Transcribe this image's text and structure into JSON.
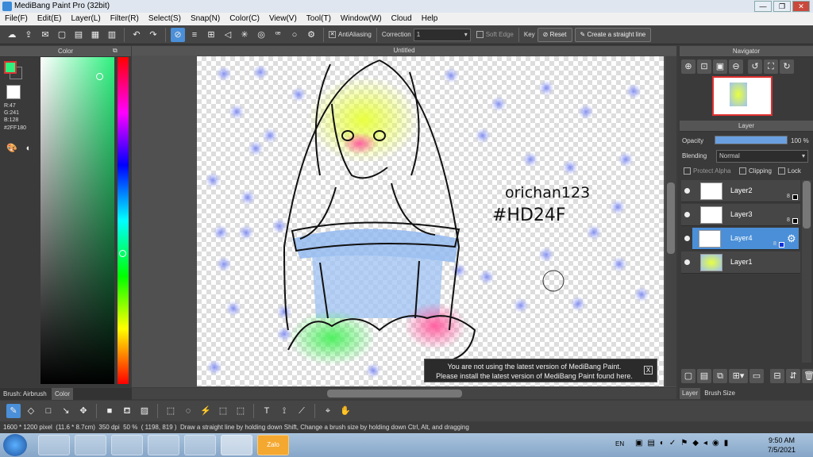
{
  "window": {
    "title": "MediBang Paint Pro (32bit)"
  },
  "menu": [
    "File(F)",
    "Edit(E)",
    "Layer(L)",
    "Filter(R)",
    "Select(S)",
    "Snap(N)",
    "Color(C)",
    "View(V)",
    "Tool(T)",
    "Window(W)",
    "Cloud",
    "Help"
  ],
  "toolbar": {
    "antialiasing_label": "AntiAliasing",
    "correction_label": "Correction",
    "correction_value": "1",
    "soft_edge_label": "Soft Edge",
    "key_label": "Key",
    "reset_label": "Reset",
    "straight_line_label": "Create a straight line"
  },
  "color_panel": {
    "title": "Color",
    "r": "R:47",
    "g": "G:241",
    "b": "B:128",
    "hex": "#2FF180",
    "fg": "#2ff180",
    "bg": "#ffffff"
  },
  "canvas": {
    "title": "Untitled",
    "text1": "orichan123",
    "text2": "#HD24F"
  },
  "notice": {
    "line1": "You are not using the latest version of MediBang Paint.",
    "line2": "Please install the latest version of MediBang Paint found here.",
    "close": "X"
  },
  "navigator": {
    "title": "Navigator"
  },
  "layer_panel": {
    "title": "Layer",
    "opacity_label": "Opacity",
    "opacity_value": "100 %",
    "opacity_fraction": 1.0,
    "blending_label": "Blending",
    "blending_value": "Normal",
    "protect_alpha": "Protect Alpha",
    "clipping": "Clipping",
    "lock": "Lock",
    "layers": [
      {
        "name": "Layer2",
        "num": "8"
      },
      {
        "name": "Layer3",
        "num": "8"
      },
      {
        "name": "Layer4",
        "num": "8"
      },
      {
        "name": "Layer1",
        "num": ""
      }
    ]
  },
  "panel_tabs": {
    "brush": "Brush: Airbrush",
    "color": "Color",
    "layer": "Layer",
    "brush_size": "Brush Size"
  },
  "status": {
    "size": "1600 * 1200 pixel",
    "cm": "(11.6 * 8.7cm)",
    "dpi": "350 dpi",
    "zoom": "50 %",
    "coords": "( 1198, 819 )",
    "hint": "Draw a straight line by holding down Shift, Change a brush size by holding down Ctrl, Alt, and dragging"
  },
  "taskbar": {
    "lang": "EN",
    "time": "9:50 AM",
    "date": "7/5/2021",
    "zalo": "Zalo"
  }
}
